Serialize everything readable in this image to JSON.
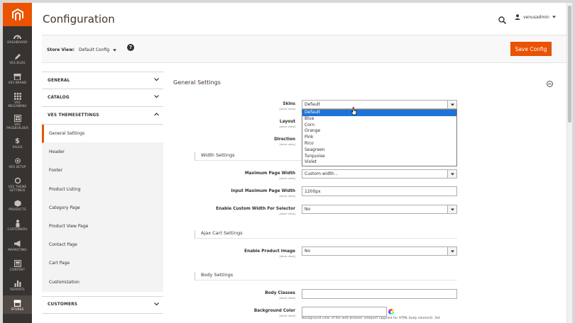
{
  "nav": {
    "items": [
      {
        "label": "DASHBOARD",
        "icon": "speedometer-icon"
      },
      {
        "label": "VES BLOG",
        "icon": "pencil-icon"
      },
      {
        "label": "VES BRAND",
        "icon": "shop-icon"
      },
      {
        "label": "VES MEGAMENU",
        "icon": "grid-icon"
      },
      {
        "label": "VES PAGEBUILDER",
        "icon": "layout-icon"
      },
      {
        "label": "SALES",
        "icon": "dollar-icon"
      },
      {
        "label": "VES SETUP",
        "icon": "gear-icon"
      },
      {
        "label": "VES THEME SETTINGS",
        "icon": "circle-icon"
      },
      {
        "label": "PRODUCTS",
        "icon": "box-icon"
      },
      {
        "label": "CUSTOMERS",
        "icon": "person-icon"
      },
      {
        "label": "MARKETING",
        "icon": "megaphone-icon"
      },
      {
        "label": "CONTENT",
        "icon": "content-icon"
      },
      {
        "label": "REPORTS",
        "icon": "bar-chart-icon"
      },
      {
        "label": "STORES",
        "icon": "store-icon"
      }
    ]
  },
  "header": {
    "title": "Configuration",
    "user": "venusadmin"
  },
  "store_view": {
    "label": "Store View:",
    "value": "Default Config",
    "help": "?",
    "save_label": "Save Config"
  },
  "tabs": {
    "general": "GENERAL",
    "catalog": "CATALOG",
    "ves_themesettings": "VES THEMESETTINGS",
    "subitems": [
      "General Settings",
      "Header",
      "Footer",
      "Product Listing",
      "Category Page",
      "Product View Page",
      "Contact Page",
      "Cart Page",
      "Customization"
    ],
    "customers": "CUSTOMERS"
  },
  "main": {
    "section_title": "General Settings",
    "scope": "[store view]",
    "skins": {
      "label": "Skins",
      "value": "Default"
    },
    "layout": {
      "label": "Layout"
    },
    "direction": {
      "label": "Direction"
    },
    "skin_options": [
      "Default",
      "Blue",
      "Corn",
      "Orange",
      "Pink",
      "Rico",
      "Seagreen",
      "Turquoise",
      "Violet"
    ],
    "width_group": "Width Settings",
    "max_width": {
      "label": "Maximum Page Width",
      "value": "Custom width..."
    },
    "input_max_width": {
      "label": "Input Maximum Page Width",
      "value": "1200px"
    },
    "custom_width_selector": {
      "label": "Enable Custom Width For Selector",
      "value": "No"
    },
    "ajax_group": "Ajax Cart Settings",
    "product_image": {
      "label": "Enable Product Image",
      "value": "No"
    },
    "body_group": "Body Settings",
    "body_classes": {
      "label": "Body Classes",
      "value": ""
    },
    "background_color": {
      "label": "Background Color",
      "value": "",
      "note": "Background color of the web browser viewport (applied for HTML body element). Set"
    }
  }
}
